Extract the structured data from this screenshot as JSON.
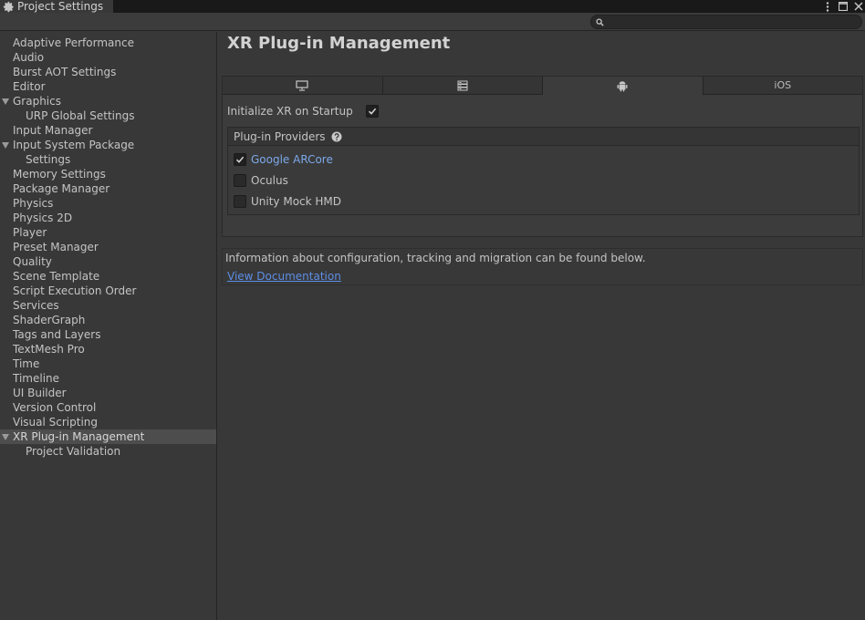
{
  "window": {
    "title": "Project Settings"
  },
  "search": {
    "value": "",
    "placeholder": ""
  },
  "sidebar": {
    "items": [
      {
        "label": "Adaptive Performance"
      },
      {
        "label": "Audio"
      },
      {
        "label": "Burst AOT Settings"
      },
      {
        "label": "Editor"
      },
      {
        "label": "Graphics"
      },
      {
        "label": "URP Global Settings"
      },
      {
        "label": "Input Manager"
      },
      {
        "label": "Input System Package"
      },
      {
        "label": "Settings"
      },
      {
        "label": "Memory Settings"
      },
      {
        "label": "Package Manager"
      },
      {
        "label": "Physics"
      },
      {
        "label": "Physics 2D"
      },
      {
        "label": "Player"
      },
      {
        "label": "Preset Manager"
      },
      {
        "label": "Quality"
      },
      {
        "label": "Scene Template"
      },
      {
        "label": "Script Execution Order"
      },
      {
        "label": "Services"
      },
      {
        "label": "ShaderGraph"
      },
      {
        "label": "Tags and Layers"
      },
      {
        "label": "TextMesh Pro"
      },
      {
        "label": "Time"
      },
      {
        "label": "Timeline"
      },
      {
        "label": "UI Builder"
      },
      {
        "label": "Version Control"
      },
      {
        "label": "Visual Scripting"
      },
      {
        "label": "XR Plug-in Management"
      },
      {
        "label": "Project Validation"
      }
    ],
    "selected": "XR Plug-in Management"
  },
  "main": {
    "title": "XR Plug-in Management",
    "platform_tabs": [
      {
        "icon": "desktop-icon",
        "label": ""
      },
      {
        "icon": "server-icon",
        "label": ""
      },
      {
        "icon": "android-icon",
        "label": ""
      },
      {
        "icon": "",
        "label": "iOS"
      }
    ],
    "active_tab": 2,
    "init_label": "Initialize XR on Startup",
    "init_checked": true,
    "providers_header": "Plug-in Providers",
    "providers": [
      {
        "label": "Google ARCore",
        "checked": true
      },
      {
        "label": "Oculus",
        "checked": false
      },
      {
        "label": "Unity Mock HMD",
        "checked": false
      }
    ],
    "info_text": "Information about configuration, tracking and migration can be found below.",
    "doc_link": "View Documentation"
  },
  "colors": {
    "background": "#383838",
    "link": "#5d8ee6",
    "provider_active": "#7ca8e8"
  }
}
